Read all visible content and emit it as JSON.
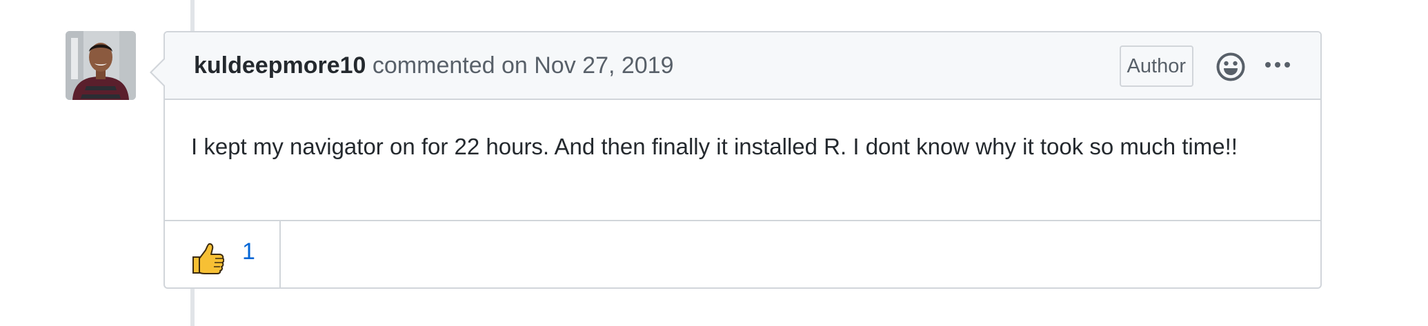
{
  "comment": {
    "author": "kuldeepmore10",
    "action_text": " commented on Nov 27, 2019",
    "author_badge": "Author",
    "body": "I kept my navigator on for 22 hours. And then finally it installed R. I dont know why it took so much time!!",
    "icons": {
      "avatar": "user-avatar",
      "emoji": "smiley-icon",
      "more": "kebab-horizontal-icon"
    },
    "reactions": [
      {
        "icon": "thumbs-up-icon",
        "count": "1"
      }
    ]
  },
  "colors": {
    "header_bg": "#f6f8fa",
    "border": "#d1d5da",
    "text": "#24292e",
    "muted": "#586069",
    "link": "#0366d6"
  }
}
